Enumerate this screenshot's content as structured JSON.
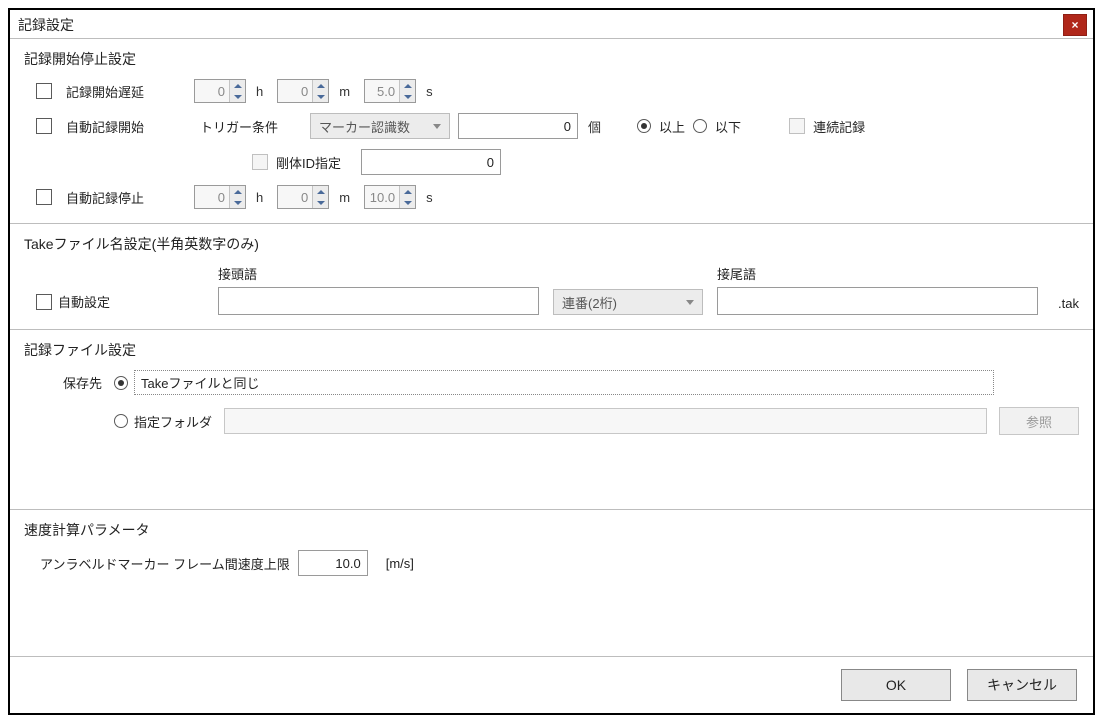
{
  "title": "記録設定",
  "close_glyph": "×",
  "section1": {
    "heading": "記録開始停止設定",
    "delay_label": "記録開始遅延",
    "delay_h": "0",
    "delay_m": "0",
    "delay_s": "5.0",
    "unit_h": "h",
    "unit_m": "m",
    "unit_s": "s",
    "auto_start_label": "自動記録開始",
    "trigger_label": "トリガー条件",
    "trigger_select": "マーカー認識数",
    "trigger_count": "0",
    "trigger_unit": "個",
    "gte_label": "以上",
    "lte_label": "以下",
    "continuous_label": "連続記録",
    "rigid_label": "剛体ID指定",
    "rigid_value": "0",
    "auto_stop_label": "自動記録停止",
    "stop_h": "0",
    "stop_m": "0",
    "stop_s": "10.0"
  },
  "section2": {
    "heading": "Takeファイル名設定(半角英数字のみ)",
    "auto_label": "自動設定",
    "prefix_label": "接頭語",
    "number_select": "連番(2桁)",
    "suffix_label": "接尾語",
    "ext": ".tak"
  },
  "section3": {
    "heading": "記録ファイル設定",
    "save_to_label": "保存先",
    "same_as_take": "Takeファイルと同じ",
    "specify_folder": "指定フォルダ",
    "browse": "参照"
  },
  "section4": {
    "heading": "速度計算パラメータ",
    "speed_label": "アンラベルドマーカー フレーム間速度上限",
    "speed_value": "10.0",
    "speed_unit": "[m/s]"
  },
  "footer": {
    "ok": "OK",
    "cancel": "キャンセル"
  }
}
